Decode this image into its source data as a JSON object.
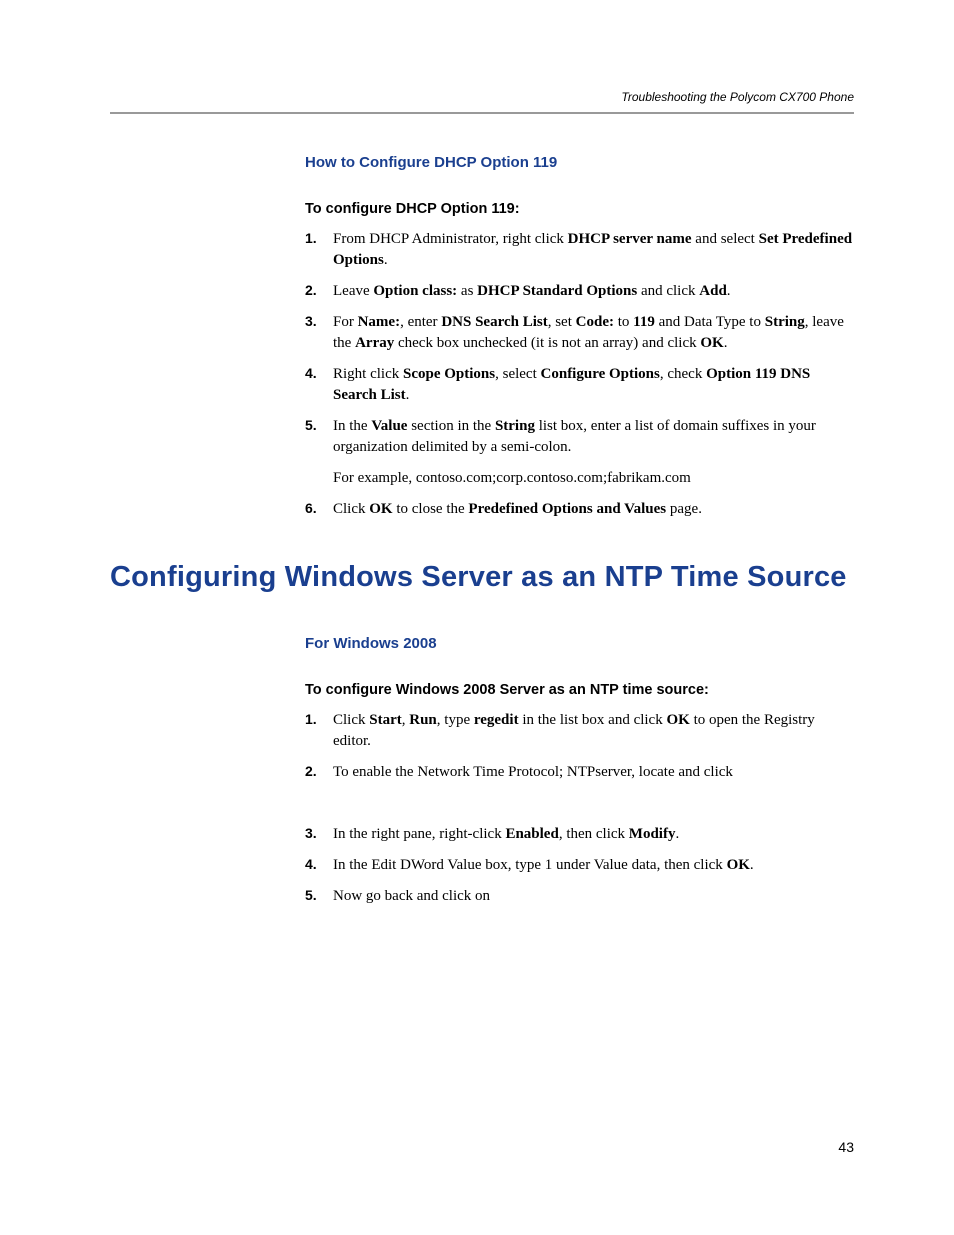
{
  "header": {
    "running_title": "Troubleshooting the Polycom CX700 Phone"
  },
  "section1": {
    "title": "How to Configure DHCP Option 119",
    "lead": "To configure DHCP Option 119:",
    "steps": [
      "From DHCP Administrator, right click <b>DHCP server name</b> and select <b>Set Predefined Options</b>.",
      "Leave <b>Option class:</b> as <b>DHCP Standard Options</b> and click <b>Add</b>.",
      "For <b>Name:</b>, enter <b>DNS Search List</b>, set <b>Code:</b> to <b>119</b> and Data Type to <b>String</b>, leave the <b>Array</b> check box unchecked (it is not an array) and click <b>OK</b>.",
      "Right click <b>Scope Options</b>, select <b>Configure Options</b>, check <b>Option 119 DNS Search List</b>.",
      "In the <b>Value</b> section in the <b>String</b> list box, enter a list of domain suffixes in your organization delimited by a semi-colon.<span class=\"sub\">For example, contoso.com;corp.contoso.com;fabrikam.com</span>",
      "Click <b>OK</b> to close the <b>Predefined Options and Values</b> page."
    ]
  },
  "section2": {
    "h1": "Configuring Windows Server as an NTP Time Source",
    "subtitle": "For Windows 2008",
    "lead": "To configure Windows 2008 Server as an NTP time source:",
    "steps": [
      "Click <b>Start</b>, <b>Run</b>, type <b>regedit</b> in the list box and click <b>OK</b> to open the Registry editor.",
      "To enable the Network Time Protocol; NTPserver, locate and click<span class=\"sub\">&nbsp;</span>",
      "In the right pane, right-click <b>Enabled</b>, then click <b>Modify</b>.",
      "In the Edit DWord Value box, type 1 under Value data, then click <b>OK</b>.",
      "Now go back and click on"
    ]
  },
  "page_number": "43"
}
